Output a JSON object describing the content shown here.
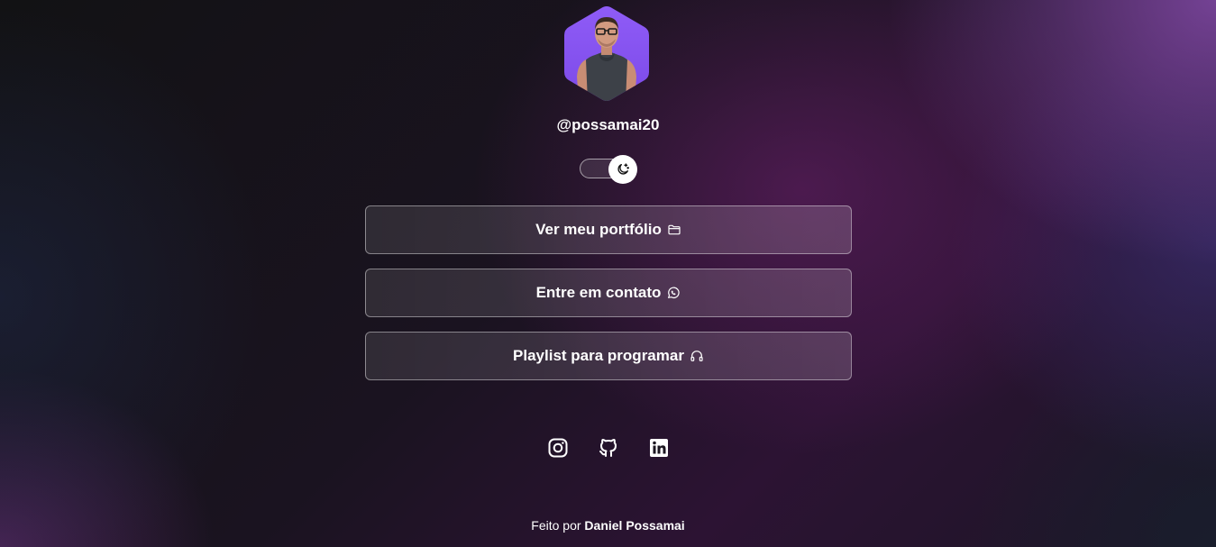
{
  "profile": {
    "username": "@possamai20",
    "avatar_icon": "person-photo-icon",
    "avatar_color": "#8b5cf6"
  },
  "theme_toggle": {
    "icon": "moon-stars-icon",
    "state": "dark"
  },
  "links": [
    {
      "label": "Ver meu portfólio",
      "icon": "folder-icon"
    },
    {
      "label": "Entre em contato",
      "icon": "whatsapp-icon"
    },
    {
      "label": "Playlist para programar",
      "icon": "headphones-icon"
    }
  ],
  "socials": [
    {
      "icon": "instagram-icon"
    },
    {
      "icon": "github-icon"
    },
    {
      "icon": "linkedin-icon"
    }
  ],
  "footer": {
    "prefix": "Feito por",
    "author": "Daniel Possamai"
  }
}
